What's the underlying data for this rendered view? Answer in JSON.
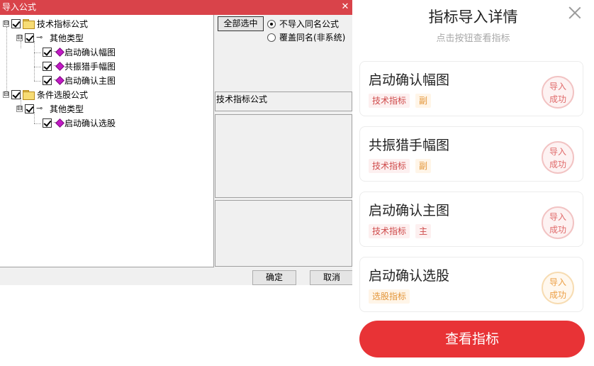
{
  "dialog": {
    "title": "导入公式",
    "close_glyph": "✕",
    "tree": {
      "root1": {
        "label": "技术指标公式",
        "exp": "⊟"
      },
      "root1_child": {
        "label": "其他类型",
        "exp": "⊟"
      },
      "root1_items": [
        "启动确认幅图",
        "共振猎手幅图",
        "启动确认主图"
      ],
      "root2": {
        "label": "条件选股公式",
        "exp": "⊟"
      },
      "root2_child": {
        "label": "其他类型",
        "exp": "⊟"
      },
      "root2_items": [
        "启动确认选股"
      ]
    },
    "select_all_label": "全部选中",
    "radio_options": [
      {
        "label": "不导入同名公式",
        "selected": true
      },
      {
        "label": "覆盖同名(非系统)",
        "selected": false
      }
    ],
    "formula_type_label": "技术指标公式",
    "ok_label": "确定",
    "cancel_label": "取消"
  },
  "sheet": {
    "title": "指标导入详情",
    "subtitle": "点击按钮查看指标",
    "cards": [
      {
        "title": "启动确认幅图",
        "tags": [
          {
            "text": "技术指标",
            "tone": "red"
          },
          {
            "text": "副",
            "tone": "orange"
          }
        ],
        "seal_line1": "导入",
        "seal_line2": "成功",
        "seal_tone": "red"
      },
      {
        "title": "共振猎手幅图",
        "tags": [
          {
            "text": "技术指标",
            "tone": "red"
          },
          {
            "text": "副",
            "tone": "orange"
          }
        ],
        "seal_line1": "导入",
        "seal_line2": "成功",
        "seal_tone": "red"
      },
      {
        "title": "启动确认主图",
        "tags": [
          {
            "text": "技术指标",
            "tone": "red"
          },
          {
            "text": "主",
            "tone": "red"
          }
        ],
        "seal_line1": "导入",
        "seal_line2": "成功",
        "seal_tone": "red"
      },
      {
        "title": "启动确认选股",
        "tags": [
          {
            "text": "选股指标",
            "tone": "orange"
          }
        ],
        "seal_line1": "导入",
        "seal_line2": "成功",
        "seal_tone": "orange"
      }
    ],
    "view_button_label": "查看指标"
  },
  "colors": {
    "titlebar": "#d9434a",
    "primary": "#e83336",
    "tag_red": "#cf4b4b",
    "tag_orange": "#e3963a"
  }
}
